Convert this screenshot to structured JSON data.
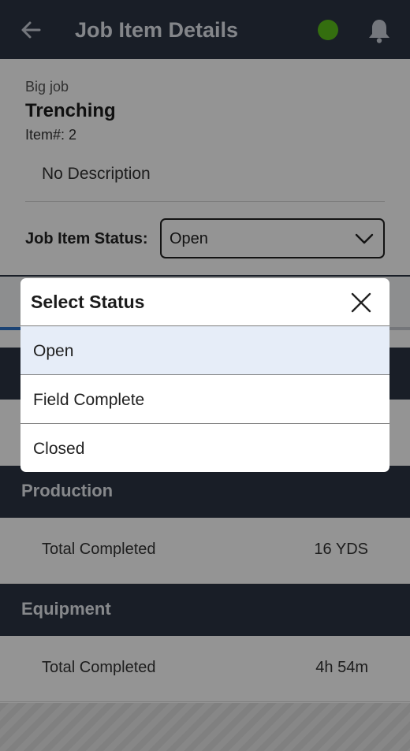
{
  "header": {
    "title": "Job Item Details",
    "status_color": "#5bbd1b"
  },
  "details": {
    "job_name": "Big job",
    "item_name": "Trenching",
    "item_number": "Item#: 2",
    "description": "No Description",
    "status_label": "Job Item Status:",
    "status_value": "Open"
  },
  "sections": {
    "production": {
      "title": "Production",
      "row_label": "Total Completed",
      "row_value": "16 YDS"
    },
    "equipment": {
      "title": "Equipment",
      "row_label": "Total Completed",
      "row_value": "4h 54m"
    }
  },
  "modal": {
    "title": "Select Status",
    "options": [
      "Open",
      "Field Complete",
      "Closed"
    ],
    "selected": "Open"
  },
  "colors": {
    "header_bg": "#2b3444",
    "accent": "#2f74c9",
    "selected_bg": "#e6edf8"
  }
}
